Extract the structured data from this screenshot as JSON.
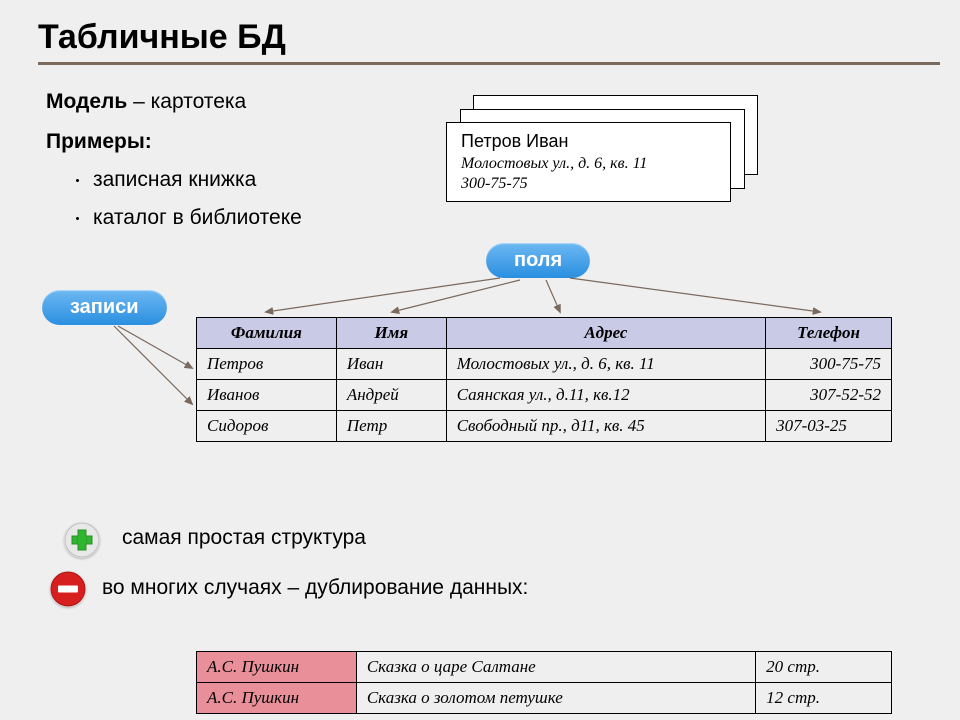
{
  "title": "Табличные БД",
  "model_label": "Модель",
  "model_value": " – картотека",
  "examples_label": "Примеры:",
  "examples": [
    "записная книжка",
    "каталог в библиотеке"
  ],
  "card": {
    "name": "Петров Иван",
    "addr": "Молостовых ул., д. 6, кв. 11",
    "phone": "300-75-75"
  },
  "pill_records": "записи",
  "pill_fields": "поля",
  "table": {
    "headers": [
      "Фамилия",
      "Имя",
      "Адрес",
      "Телефон"
    ],
    "rows": [
      [
        "Петров",
        "Иван",
        "Молостовых ул., д. 6, кв. 11",
        "300-75-75"
      ],
      [
        "Иванов",
        "Андрей",
        "Саянская ул., д.11, кв.12",
        "307-52-52"
      ],
      [
        "Сидоров",
        "Петр",
        "Свободный пр., д11, кв. 45",
        "307-03-25"
      ]
    ]
  },
  "plus_text": "самая простая структура",
  "minus_text": "во многих случаях – дублирование данных:",
  "table2": {
    "rows": [
      [
        "А.С. Пушкин",
        "Сказка о царе Салтане",
        "20 стр."
      ],
      [
        "А.С. Пушкин",
        "Сказка о золотом петушке",
        "12 стр."
      ]
    ]
  }
}
